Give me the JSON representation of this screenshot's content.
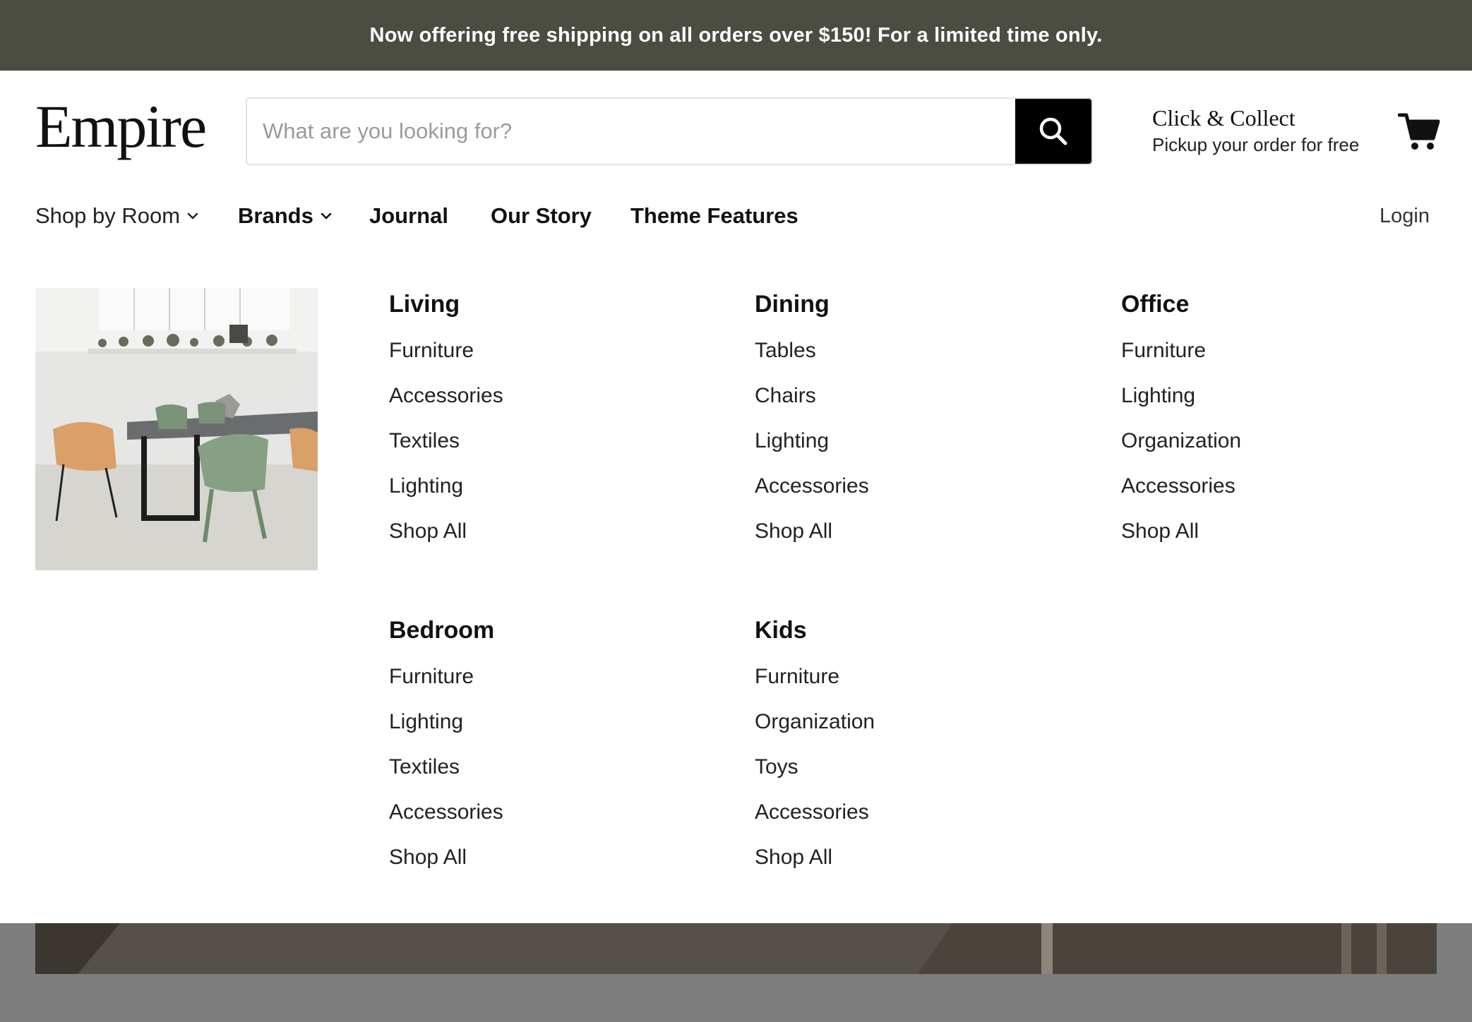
{
  "announcement": {
    "text": "Now offering free shipping on all orders over $150! For a limited time only."
  },
  "header": {
    "logo": "Empire",
    "search_placeholder": "What are you looking for?",
    "click_collect_title": "Click & Collect",
    "click_collect_subtitle": "Pickup your order for free"
  },
  "nav": {
    "items": [
      {
        "label": "Shop by Room",
        "has_dropdown": true
      },
      {
        "label": "Brands",
        "has_dropdown": true
      },
      {
        "label": "Journal",
        "has_dropdown": false
      },
      {
        "label": "Our Story",
        "has_dropdown": false
      },
      {
        "label": "Theme Features",
        "has_dropdown": false
      }
    ],
    "login": "Login"
  },
  "mega_menu": {
    "columns": [
      {
        "heading": "Living",
        "links": [
          "Furniture",
          "Accessories",
          "Textiles",
          "Lighting",
          "Shop All"
        ]
      },
      {
        "heading": "Dining",
        "links": [
          "Tables",
          "Chairs",
          "Lighting",
          "Accessories",
          "Shop All"
        ]
      },
      {
        "heading": "Office",
        "links": [
          "Furniture",
          "Lighting",
          "Organization",
          "Accessories",
          "Shop All"
        ]
      },
      {
        "heading": "Bedroom",
        "links": [
          "Furniture",
          "Lighting",
          "Textiles",
          "Accessories",
          "Shop All"
        ]
      },
      {
        "heading": "Kids",
        "links": [
          "Furniture",
          "Organization",
          "Toys",
          "Accessories",
          "Shop All"
        ]
      }
    ]
  },
  "colors": {
    "announcement_bg": "#4b4d43",
    "search_button_bg": "#000000",
    "overlay": "#7d7d7d"
  },
  "icons": {
    "search": "search-icon",
    "cart": "cart-icon",
    "chevron": "chevron-down-icon"
  }
}
